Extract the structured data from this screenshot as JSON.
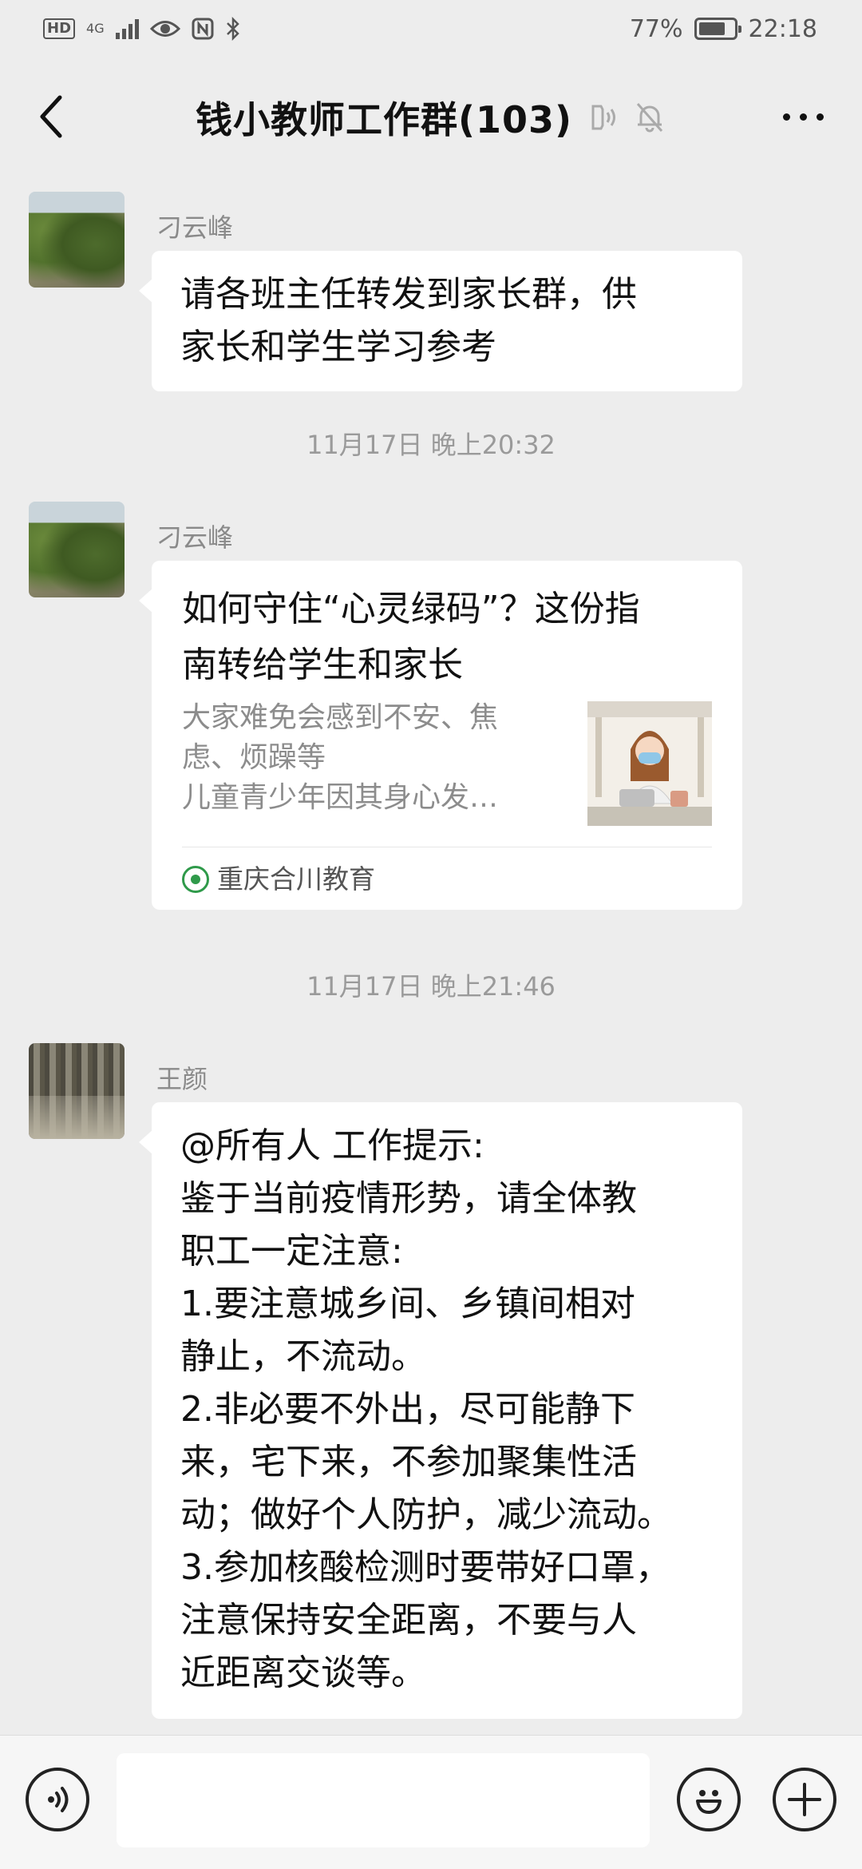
{
  "status_bar": {
    "hd": "HD",
    "network": "4G",
    "battery_percent": "77%",
    "battery_level": 0.77,
    "time": "22:18"
  },
  "header": {
    "title": "钱小教师工作群(103)",
    "icons": [
      "back-arrow-icon",
      "earpiece-mode-icon",
      "mute-bell-icon",
      "more-icon"
    ]
  },
  "messages": [
    {
      "sender": "刁云峰",
      "lines": [
        "请各班主任转发到家长群，供",
        "家长和学生学习参考"
      ]
    },
    {
      "timestamp": "11月17日 晚上20:32"
    },
    {
      "sender": "刁云峰",
      "card": {
        "title_lines": [
          "如何守住“心灵绿码”？这份指",
          "南转给学生和家长"
        ],
        "desc_lines": [
          "大家难免会感到不安、焦",
          "虑、烦躁等",
          "儿童青少年因其身心发…"
        ],
        "source": "重庆合川教育"
      }
    },
    {
      "timestamp": "11月17日 晚上21:46"
    },
    {
      "sender": "王颜",
      "lines": [
        "@所有人  工作提示:",
        "鉴于当前疫情形势，请全体教",
        "职工一定注意:",
        "1.要注意城乡间、乡镇间相对",
        "静止，不流动。",
        "2.非必要不外出，尽可能静下",
        "来，宅下来，不参加聚集性活",
        "动；做好个人防护，减少流动。",
        "3.参加核酸检测时要带好口罩，",
        "注意保持安全距离，不要与人",
        "近距离交谈等。"
      ]
    }
  ],
  "input_bar": {
    "icons": [
      "voice-icon",
      "emoji-icon",
      "plus-icon"
    ]
  }
}
